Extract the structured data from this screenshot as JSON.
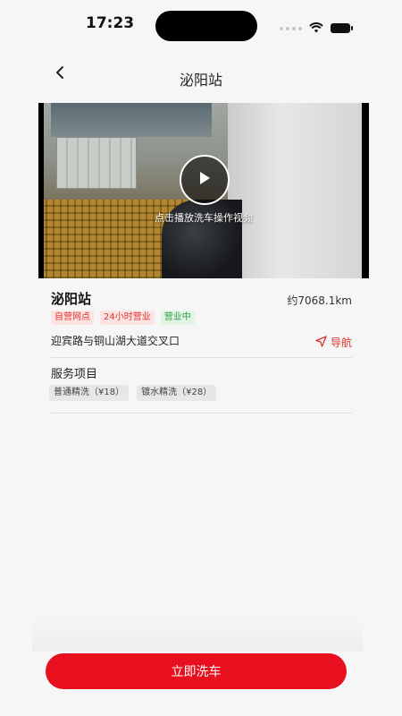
{
  "status_bar": {
    "time": "17:23"
  },
  "nav": {
    "title": "泌阳站",
    "back_icon": "chevron-left-icon"
  },
  "video": {
    "play_hint": "点击播放洗车操作视频",
    "play_icon": "play-icon"
  },
  "station": {
    "name": "泌阳站",
    "distance": "约7068.1km",
    "tags": [
      {
        "label": "自营网点",
        "style": "red"
      },
      {
        "label": "24小时营业",
        "style": "red"
      },
      {
        "label": "营业中",
        "style": "green"
      }
    ],
    "address": "迎宾路与铜山湖大道交叉口",
    "nav_label": "导航",
    "nav_icon": "navigation-arrow-icon"
  },
  "services": {
    "title": "服务项目",
    "items": [
      "普通精洗（¥18）",
      "镀水精洗（¥28）"
    ]
  },
  "action": {
    "wash_button_label": "立即洗车"
  },
  "colors": {
    "accent_red": "#e8101e",
    "tag_red_text": "#e0322c",
    "tag_red_bg": "#fde4e4",
    "tag_green_text": "#2e9c48",
    "tag_green_bg": "#e2f5e4",
    "page_background": "#f6f6f6"
  }
}
